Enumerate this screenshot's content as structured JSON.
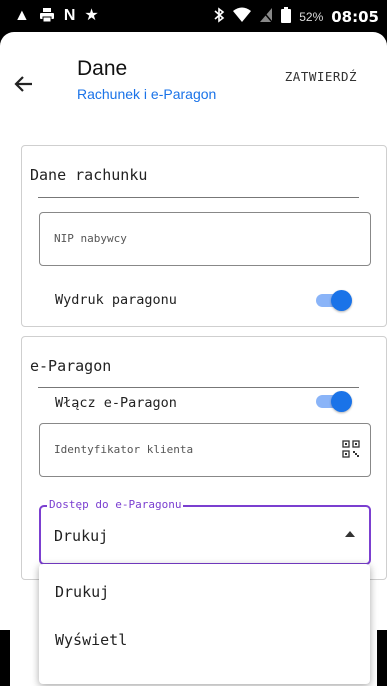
{
  "status_bar": {
    "icons_left": [
      "warning-icon",
      "printer-icon",
      "n-icon",
      "star-icon"
    ],
    "icons_right": [
      "bluetooth-icon",
      "wifi-icon",
      "no-sim-icon",
      "battery-icon"
    ],
    "battery": "52%",
    "time": "08:05"
  },
  "header": {
    "title": "Dane",
    "subtitle": "Rachunek i e-Paragon",
    "confirm_label": "ZATWIERDŹ"
  },
  "receipt_section": {
    "title": "Dane rachunku",
    "nip_placeholder": "NIP nabywcy",
    "print_label": "Wydruk paragonu",
    "print_enabled": true
  },
  "eparagon_section": {
    "title": "e-Paragon",
    "enable_label": "Włącz e-Paragon",
    "enable_enabled": true,
    "client_id_placeholder": "Identyfikator klienta",
    "access_label": "Dostęp do e-Paragonu",
    "access_value": "Drukuj"
  },
  "dropdown": {
    "options": [
      "Drukuj",
      "Wyświetl"
    ]
  },
  "colors": {
    "accent": "#1a73e8",
    "focus": "#7b3fd0"
  }
}
